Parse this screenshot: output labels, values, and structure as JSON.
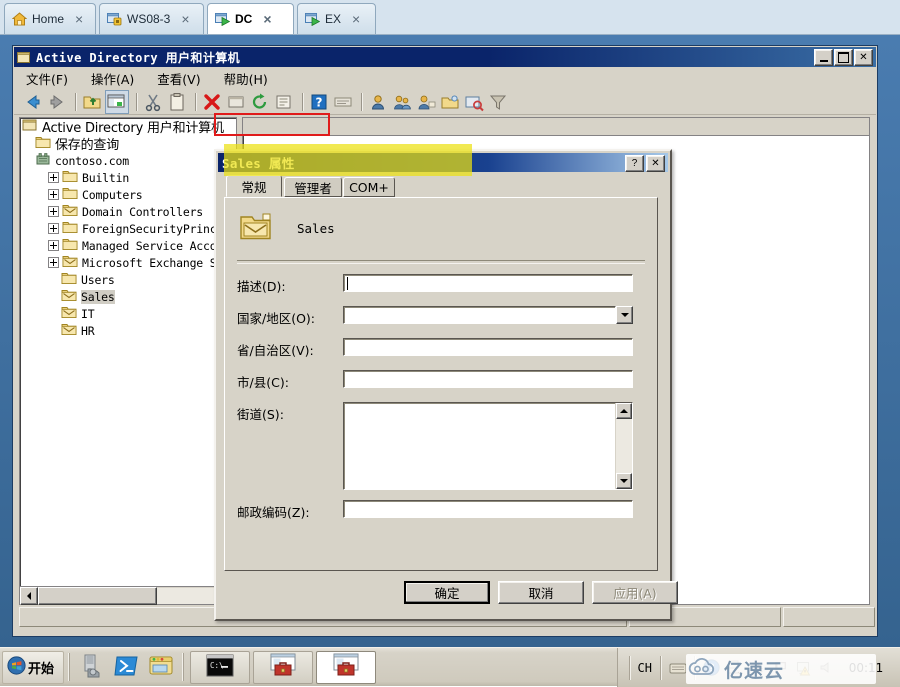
{
  "browser_tabs": [
    {
      "label": "Home",
      "icon": "home-icon",
      "close": "×",
      "active": false
    },
    {
      "label": "WS08-3",
      "icon": "vm-paused-icon",
      "close": "×",
      "active": false
    },
    {
      "label": "DC",
      "icon": "vm-running-icon",
      "close": "×",
      "active": true
    },
    {
      "label": "EX",
      "icon": "vm-running-icon",
      "close": "×",
      "active": false
    }
  ],
  "mmc": {
    "title": "Active Directory 用户和计算机",
    "window_buttons": [
      {
        "name": "minimize-button",
        "glyph": "–"
      },
      {
        "name": "maximize-button",
        "glyph": "❐"
      },
      {
        "name": "close-button",
        "glyph": "✕"
      }
    ],
    "menus": [
      "文件(F)",
      "操作(A)",
      "查看(V)",
      "帮助(H)"
    ],
    "toolbar_icons": [
      "back-arrow-icon",
      "forward-arrow-icon",
      "sep",
      "up-folder-icon",
      "show-hide-console-tree-icon",
      "sep",
      "cut-icon",
      "paste-icon",
      "sep",
      "delete-icon",
      "properties-icon",
      "refresh-icon",
      "export-list-icon",
      "sep",
      "help-icon",
      "window-icon",
      "sep",
      "new-user-icon",
      "new-group-icon",
      "new-contact-icon",
      "new-ou-icon",
      "find-icon",
      "filter-icon"
    ],
    "tree": [
      {
        "label": "Active Directory 用户和计算机",
        "indent": 0,
        "expander": "none",
        "icon": "console-root-icon",
        "selected": false,
        "cjk": true
      },
      {
        "label": "保存的查询",
        "indent": 1,
        "expander": "none",
        "icon": "folder-icon",
        "selected": false,
        "cjk": true
      },
      {
        "label": "contoso.com",
        "indent": 1,
        "expander": "none",
        "icon": "domain-icon",
        "selected": false,
        "cjk": false
      },
      {
        "label": "Builtin",
        "indent": 2,
        "expander": "plus",
        "icon": "folder-icon",
        "selected": false,
        "cjk": false
      },
      {
        "label": "Computers",
        "indent": 2,
        "expander": "plus",
        "icon": "folder-icon",
        "selected": false,
        "cjk": false
      },
      {
        "label": "Domain Controllers",
        "indent": 2,
        "expander": "plus",
        "icon": "ou-icon",
        "selected": false,
        "cjk": false
      },
      {
        "label": "ForeignSecurityPrincip",
        "indent": 2,
        "expander": "plus",
        "icon": "folder-icon",
        "selected": false,
        "cjk": false
      },
      {
        "label": "Managed Service Accou",
        "indent": 2,
        "expander": "plus",
        "icon": "folder-icon",
        "selected": false,
        "cjk": false
      },
      {
        "label": "Microsoft Exchange Se",
        "indent": 2,
        "expander": "plus",
        "icon": "ou-icon",
        "selected": false,
        "cjk": false
      },
      {
        "label": "Users",
        "indent": 2,
        "expander": "none",
        "icon": "folder-icon",
        "selected": false,
        "cjk": false
      },
      {
        "label": "Sales",
        "indent": 2,
        "expander": "none",
        "icon": "ou-icon",
        "selected": true,
        "cjk": false
      },
      {
        "label": "IT",
        "indent": 2,
        "expander": "none",
        "icon": "ou-icon",
        "selected": false,
        "cjk": false
      },
      {
        "label": "HR",
        "indent": 2,
        "expander": "none",
        "icon": "ou-icon",
        "selected": false,
        "cjk": false
      }
    ],
    "hscroll": {
      "left_arrow": "◄",
      "right_arrow": "►"
    }
  },
  "dialog": {
    "title": "Sales 属性",
    "window_buttons": [
      {
        "name": "help-button",
        "glyph": "?"
      },
      {
        "name": "close-button",
        "glyph": "✕"
      }
    ],
    "tabs": [
      {
        "label": "常规",
        "active": true
      },
      {
        "label": "管理者",
        "active": false
      },
      {
        "label": "COM+",
        "active": false
      }
    ],
    "object_name": "Sales",
    "object_icon": "ou-large-icon",
    "fields": [
      {
        "name": "description",
        "label": "描述(D):",
        "type": "text",
        "value": "",
        "focused": true
      },
      {
        "name": "country",
        "label": "国家/地区(O):",
        "type": "combo",
        "value": ""
      },
      {
        "name": "province",
        "label": "省/自治区(V):",
        "type": "text",
        "value": ""
      },
      {
        "name": "city",
        "label": "市/县(C):",
        "type": "text",
        "value": ""
      },
      {
        "name": "street",
        "label": "街道(S):",
        "type": "textarea",
        "value": ""
      },
      {
        "name": "postal",
        "label": "邮政编码(Z):",
        "type": "text",
        "value": ""
      }
    ],
    "buttons": [
      {
        "name": "ok-button",
        "label": "确定",
        "default": true,
        "disabled": false
      },
      {
        "name": "cancel-button",
        "label": "取消",
        "default": false,
        "disabled": false
      },
      {
        "name": "apply-button",
        "label": "应用(A)",
        "default": false,
        "disabled": true
      }
    ]
  },
  "annotations": {
    "title_box_color": "#e01b1b",
    "tab_highlight_color": "#ece111"
  },
  "taskbar": {
    "start_label": "开始",
    "quick_launch": [
      "server-manager-icon",
      "powershell-icon",
      "explorer-icon"
    ],
    "task_buttons": [
      {
        "name": "taskbtn-cmd",
        "icon": "command-prompt-icon",
        "active": false
      },
      {
        "name": "taskbtn-mmc-1",
        "icon": "mmc-briefcase-icon",
        "active": false
      },
      {
        "name": "taskbtn-mmc-2",
        "icon": "mmc-briefcase-icon",
        "active": true
      }
    ],
    "tray": {
      "ime": "CH",
      "icons": [
        "keyboard-icon",
        "help-icon",
        "network-icon",
        "show-hidden-icon",
        "flag-icon",
        "action-center-icon",
        "volume-icon"
      ],
      "clock": "00:11"
    }
  },
  "watermark": {
    "text": "亿速云",
    "icon": "cloud-icon"
  }
}
